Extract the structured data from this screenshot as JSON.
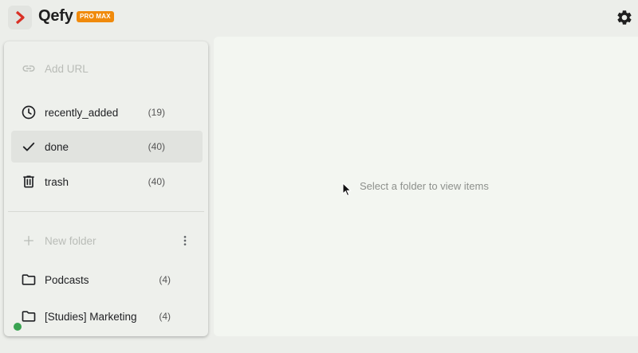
{
  "header": {
    "brand": "Qefy",
    "badge": "PRO MAX",
    "icons": {
      "logo": "qefy-logo",
      "settings": "gear-icon"
    }
  },
  "sidebar": {
    "add_url": {
      "label": "Add URL",
      "icon": "link-icon"
    },
    "system_folders": [
      {
        "label": "recently_added",
        "count": "(19)",
        "icon": "clock-icon"
      },
      {
        "label": "done",
        "count": "(40)",
        "icon": "check-icon",
        "active": true
      },
      {
        "label": "trash",
        "count": "(40)",
        "icon": "trash-icon"
      }
    ],
    "new_folder": {
      "label": "New folder",
      "icon": "plus-icon",
      "menu_icon": "more-vertical-icon"
    },
    "folders": [
      {
        "label": "Podcasts",
        "count": "(4)",
        "icon": "folder-icon"
      },
      {
        "label": "[Studies] Marketing",
        "count": "(4)",
        "icon": "folder-icon"
      }
    ]
  },
  "main": {
    "empty_message": "Select a folder to view items"
  },
  "colors": {
    "badge": "#f08a0c",
    "logo_red": "#d93025",
    "status_dot": "#3aa351",
    "active_row": "#e1e3df"
  }
}
